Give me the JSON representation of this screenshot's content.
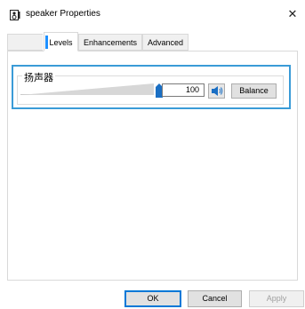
{
  "window": {
    "title": "speaker Properties",
    "close_glyph": "✕",
    "title_icon": "speaker-device-icon"
  },
  "tabs": [
    {
      "label": "Levels",
      "selected": true
    },
    {
      "label": "Enhancements",
      "selected": false
    },
    {
      "label": "Advanced",
      "selected": false
    }
  ],
  "levels": {
    "group_label": "扬声器",
    "volume": "100",
    "volume_fraction": 1.0,
    "speaker_icon": "speaker-mute-toggle-icon",
    "balance_label": "Balance"
  },
  "footer": {
    "ok_label": "OK",
    "cancel_label": "Cancel",
    "apply_label": "Apply",
    "apply_enabled": false
  },
  "colors": {
    "accent": "#0078d7",
    "group_highlight": "#3a9bd7",
    "slider_fill": "#1a6fc4"
  }
}
